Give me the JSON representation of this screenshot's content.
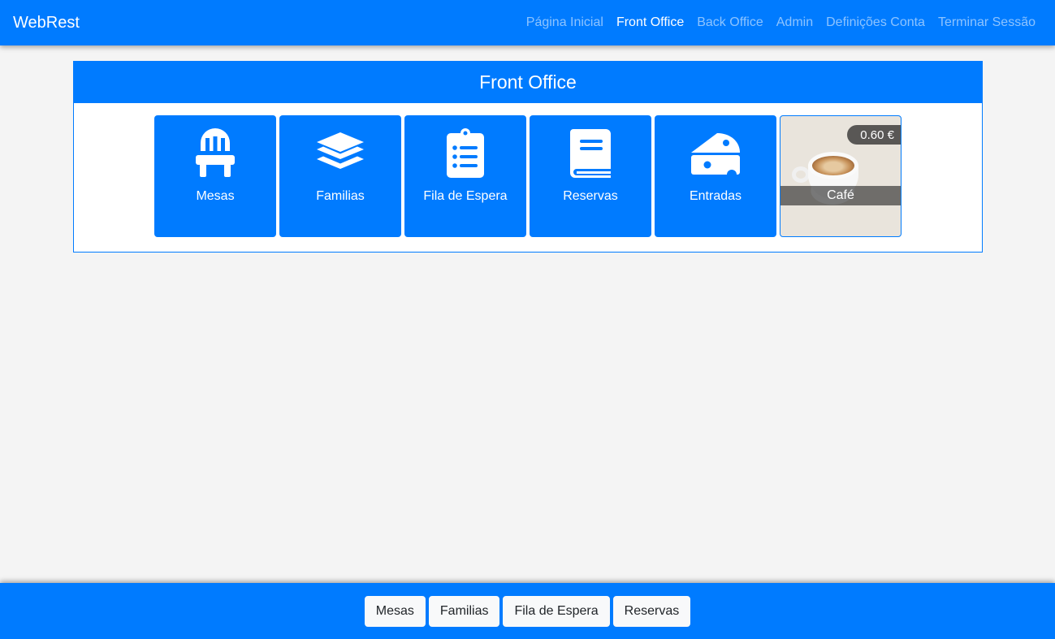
{
  "navbar": {
    "brand": "WebRest",
    "links": [
      {
        "label": "Página Inicial",
        "active": false
      },
      {
        "label": "Front Office",
        "active": true
      },
      {
        "label": "Back Office",
        "active": false
      },
      {
        "label": "Admin",
        "active": false
      },
      {
        "label": "Definições Conta",
        "active": false
      },
      {
        "label": "Terminar Sessão",
        "active": false
      }
    ]
  },
  "panel": {
    "title": "Front Office",
    "tiles": [
      {
        "label": "Mesas",
        "icon": "chair-icon"
      },
      {
        "label": "Familias",
        "icon": "layers-icon"
      },
      {
        "label": "Fila de Espera",
        "icon": "clipboard-list-icon"
      },
      {
        "label": "Reservas",
        "icon": "book-icon"
      },
      {
        "label": "Entradas",
        "icon": "cheese-icon"
      },
      {
        "label": "Café",
        "price": "0.60 €",
        "icon": "coffee-image"
      }
    ]
  },
  "footer": {
    "buttons": [
      "Mesas",
      "Familias",
      "Fila de Espera",
      "Reservas"
    ]
  },
  "colors": {
    "primary": "#007bff",
    "background": "#f4f4f4",
    "button_light": "#f8f9fa"
  }
}
